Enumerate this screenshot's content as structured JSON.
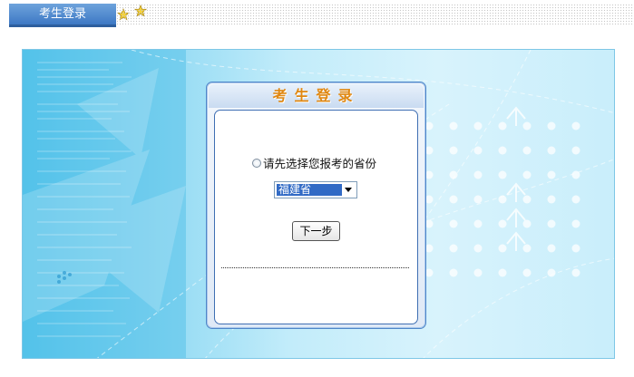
{
  "topbar": {
    "tab_label": "考生登录",
    "icons": [
      "star-icon",
      "star-icon"
    ]
  },
  "dialog": {
    "title": "考生登录",
    "prompt": "请先选择您报考的省份",
    "province_select": {
      "value": "福建省"
    },
    "next_button": "下一步"
  },
  "colors": {
    "tab_blue": "#3d78c4",
    "title_orange": "#e08812",
    "select_highlight": "#316ac5",
    "background_cyan": "#8fd9f3"
  }
}
